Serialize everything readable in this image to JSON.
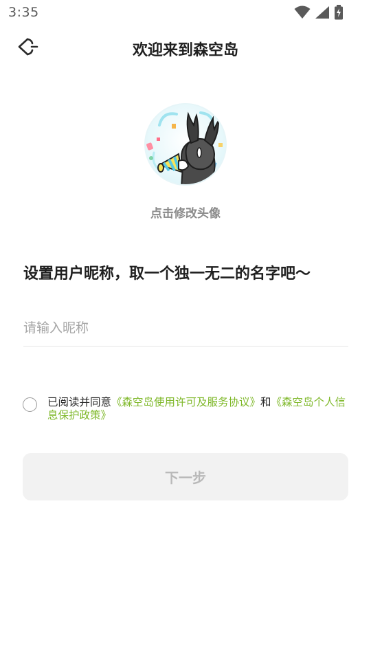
{
  "status_bar": {
    "time": "3:35",
    "icons": [
      "wifi-icon",
      "signal-icon",
      "battery-charging-icon"
    ]
  },
  "header": {
    "back_icon": "back-arrow-icon",
    "title": "欢迎来到森空岛"
  },
  "avatar": {
    "hint": "点击修改头像"
  },
  "nickname": {
    "prompt": "设置用户昵称，取一个独一无二的名字吧～",
    "placeholder": "请输入昵称",
    "value": ""
  },
  "agreement": {
    "checked": false,
    "prefix": "已阅读并同意",
    "link1": "《森空岛使用许可及服务协议》",
    "conjunction": "和",
    "link2": "《森空岛个人信息保护政策》"
  },
  "next_button": {
    "label": "下一步",
    "enabled": false
  },
  "colors": {
    "link": "#7fb82a",
    "button_bg_disabled": "#f2f2f2",
    "button_text_disabled": "#b9b9b9"
  }
}
